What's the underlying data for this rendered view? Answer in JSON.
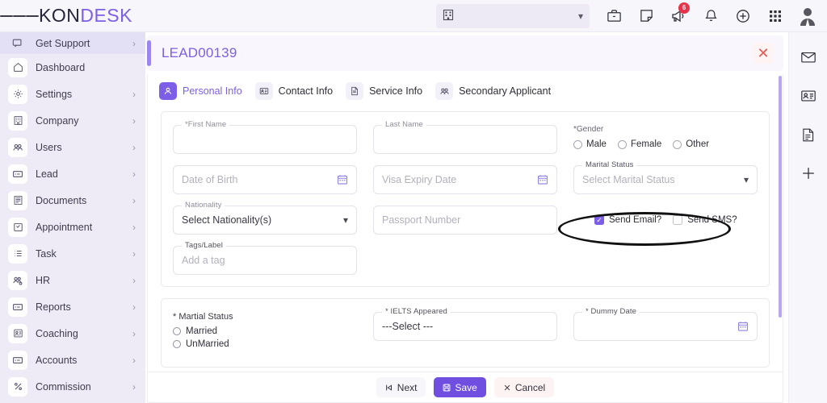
{
  "topbar": {
    "menu_icon": "hamburger-icon",
    "brand_part1": "KON",
    "brand_part2": "DESK",
    "company_select_value": "",
    "company_icon": "building-icon",
    "icons": [
      {
        "name": "briefcase-icon",
        "label": "Briefcase"
      },
      {
        "name": "note-icon",
        "label": "Notes"
      },
      {
        "name": "megaphone-icon",
        "label": "Announcements",
        "badge": "6"
      },
      {
        "name": "bell-icon",
        "label": "Notifications"
      },
      {
        "name": "plus-circle-icon",
        "label": "Add"
      },
      {
        "name": "grid-apps-icon",
        "label": "Apps"
      },
      {
        "name": "user-avatar-icon",
        "label": "Profile"
      }
    ]
  },
  "sidebar": {
    "support": {
      "label": "Get Support",
      "icon": "chat-support-icon"
    },
    "items": [
      {
        "label": "Dashboard",
        "icon": "home-icon",
        "chevron": false
      },
      {
        "label": "Settings",
        "icon": "gear-icon",
        "chevron": true
      },
      {
        "label": "Company",
        "icon": "building-icon",
        "chevron": true
      },
      {
        "label": "Users",
        "icon": "users-icon",
        "chevron": true
      },
      {
        "label": "Lead",
        "icon": "card-icon",
        "chevron": true
      },
      {
        "label": "Documents",
        "icon": "documents-icon",
        "chevron": true
      },
      {
        "label": "Appointment",
        "icon": "calendar-check-icon",
        "chevron": true
      },
      {
        "label": "Task",
        "icon": "task-list-icon",
        "chevron": true
      },
      {
        "label": "HR",
        "icon": "people-gear-icon",
        "chevron": true
      },
      {
        "label": "Reports",
        "icon": "report-icon",
        "chevron": true
      },
      {
        "label": "Coaching",
        "icon": "coaching-icon",
        "chevron": true
      },
      {
        "label": "Accounts",
        "icon": "accounts-icon",
        "chevron": true
      },
      {
        "label": "Commission",
        "icon": "percent-icon",
        "chevron": true
      }
    ]
  },
  "main": {
    "lead_title": "LEAD00139",
    "close_icon": "close-icon",
    "tabs": [
      {
        "label": "Personal Info",
        "icon": "person-icon",
        "active": true
      },
      {
        "label": "Contact Info",
        "icon": "contact-card-icon",
        "active": false
      },
      {
        "label": "Service Info",
        "icon": "file-icon",
        "active": false
      },
      {
        "label": "Secondary Applicant",
        "icon": "people-icon",
        "active": false
      }
    ],
    "form": {
      "first_name": {
        "label": "*First Name",
        "value": "",
        "placeholder": ""
      },
      "last_name": {
        "label": "Last Name",
        "value": "",
        "placeholder": ""
      },
      "gender": {
        "label": "*Gender",
        "options": [
          "Male",
          "Female",
          "Other"
        ],
        "selected": ""
      },
      "date_of_birth": {
        "label": "",
        "placeholder": "Date of Birth",
        "value": "",
        "icon": "calendar-icon"
      },
      "visa_expiry_date": {
        "label": "",
        "placeholder": "Visa Expiry Date",
        "value": "",
        "icon": "calendar-icon"
      },
      "marital_status": {
        "label": "Marital Status",
        "placeholder": "Select Marital Status",
        "value": "",
        "icon": "chevron-down-icon"
      },
      "nationality": {
        "label": "Nationality",
        "placeholder": "Select Nationality(s)",
        "value": "Select Nationality(s)",
        "icon": "chevron-down-icon"
      },
      "passport_number": {
        "label": "",
        "placeholder": "Passport Number",
        "value": ""
      },
      "send_email": {
        "label": "Send Email?",
        "checked": true
      },
      "send_sms": {
        "label": "Send SMS?",
        "checked": false
      },
      "tags_label": {
        "label": "Tags/Label",
        "placeholder": "Add a tag",
        "value": ""
      },
      "martial_status2": {
        "label": "* Martial Status",
        "options": [
          "Married",
          "UnMarried"
        ],
        "selected": ""
      },
      "ielts_appeared": {
        "label": "* IELTS Appeared",
        "value": "---Select ---"
      },
      "dummy_date": {
        "label": "* Dummy Date",
        "value": "",
        "placeholder": "",
        "icon": "calendar-icon"
      }
    },
    "footer": {
      "next": {
        "label": "Next",
        "icon": "skip-next-icon"
      },
      "save": {
        "label": "Save",
        "icon": "save-icon"
      },
      "cancel": {
        "label": "Cancel",
        "icon": "x-icon"
      }
    }
  },
  "rightbar": {
    "items": [
      {
        "name": "mail-icon",
        "label": "Mail"
      },
      {
        "name": "id-card-icon",
        "label": "Contact Card"
      },
      {
        "name": "document-icon",
        "label": "Document"
      },
      {
        "name": "plus-icon",
        "label": "Add"
      }
    ]
  },
  "colors": {
    "accent": "#7c5fe6",
    "sidebar_bg": "#eeebf7",
    "badge_red": "#e8344a",
    "annotation": "#111111"
  }
}
